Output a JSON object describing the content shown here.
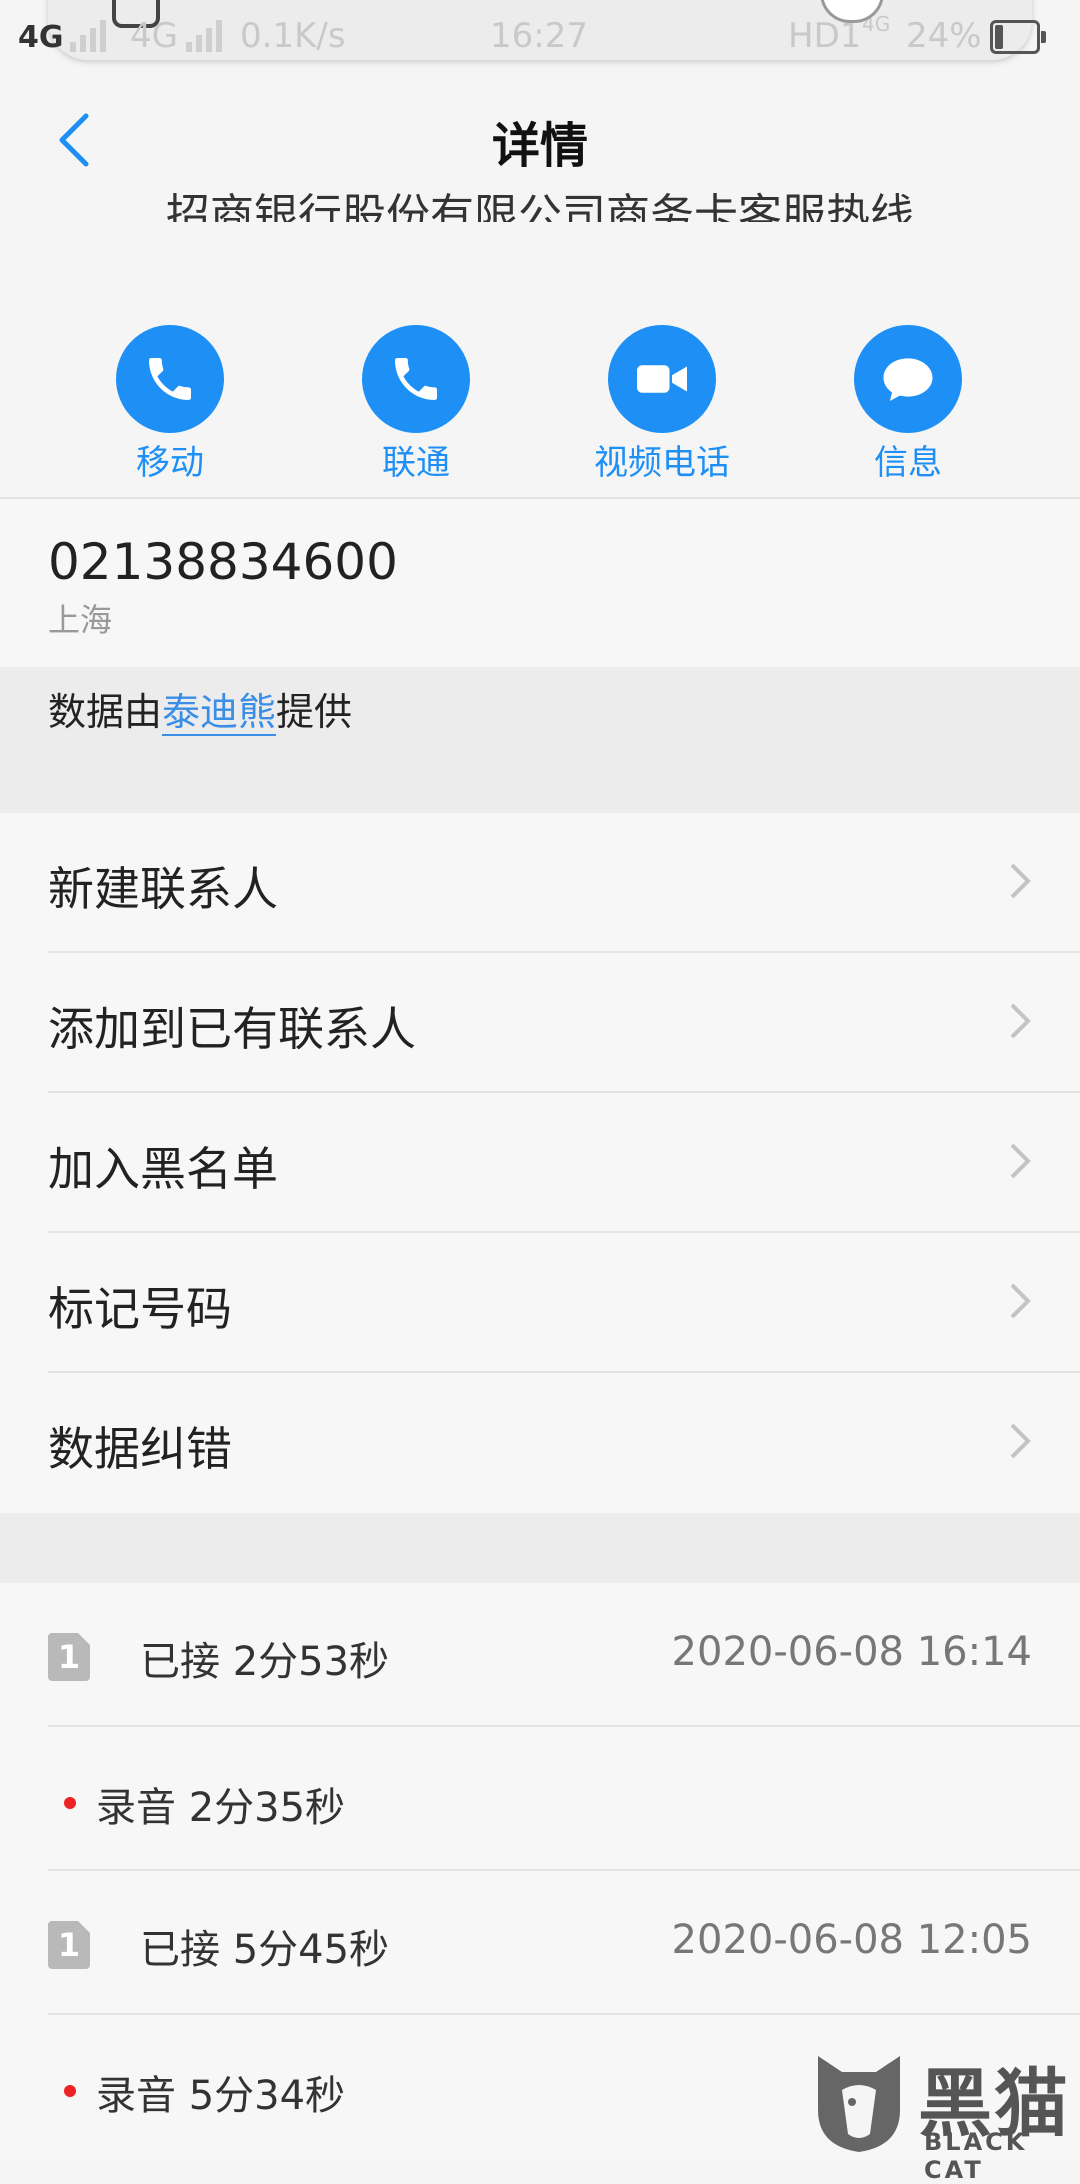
{
  "status_bar": {
    "network_left": "4G",
    "network_dim": "4G",
    "speed": "0.1K/s",
    "time": "16:27",
    "hd_label": "HD1",
    "network_small": "4G",
    "battery": "24%"
  },
  "header": {
    "title": "详情",
    "company_name": "招商银行股份有限公司商务卡客服热线"
  },
  "actions": [
    {
      "label": "移动",
      "icon": "phone-icon"
    },
    {
      "label": "联通",
      "icon": "phone-icon"
    },
    {
      "label": "视频电话",
      "icon": "video-camera-icon"
    },
    {
      "label": "信息",
      "icon": "message-bubble-icon"
    }
  ],
  "contact": {
    "phone_number": "02138834600",
    "location": "上海",
    "provider_prefix": "数据由",
    "provider_name": "泰迪熊",
    "provider_suffix": "提供"
  },
  "menu": [
    {
      "label": "新建联系人"
    },
    {
      "label": "添加到已有联系人"
    },
    {
      "label": "加入黑名单"
    },
    {
      "label": "标记号码"
    },
    {
      "label": "数据纠错"
    }
  ],
  "call_log": [
    {
      "sim": "1",
      "status": "已接 2分53秒",
      "time": "2020-06-08 16:14",
      "recording": "录音 2分35秒"
    },
    {
      "sim": "1",
      "status": "已接 5分45秒",
      "time": "2020-06-08 12:05",
      "recording": "录音 5分34秒"
    }
  ],
  "watermark": {
    "title": "黑猫",
    "subtitle": "BLACK CAT"
  },
  "colors": {
    "accent": "#1e90f5",
    "recording_dot": "#ee2222"
  }
}
